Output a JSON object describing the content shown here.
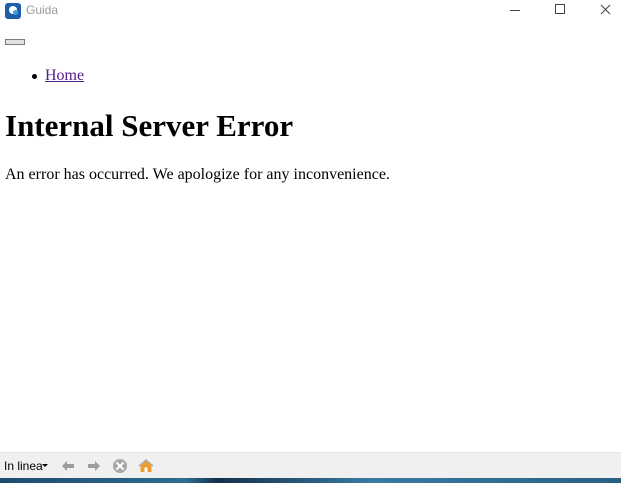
{
  "window": {
    "title": "Guida"
  },
  "nav": {
    "items": [
      {
        "label": "Home"
      }
    ]
  },
  "page": {
    "title": "Internal Server Error",
    "message": "An error has occurred. We apologize for any inconvenience."
  },
  "toolbar": {
    "mode_label": "In linea",
    "buttons": [
      {
        "icon": "back-arrow-icon"
      },
      {
        "icon": "forward-arrow-icon"
      },
      {
        "icon": "stop-icon"
      },
      {
        "icon": "home-icon"
      }
    ]
  },
  "colors": {
    "link_visited": "#551a8b",
    "toolbar_bg": "#f0f0f0",
    "title_text": "#9a9a9a"
  }
}
